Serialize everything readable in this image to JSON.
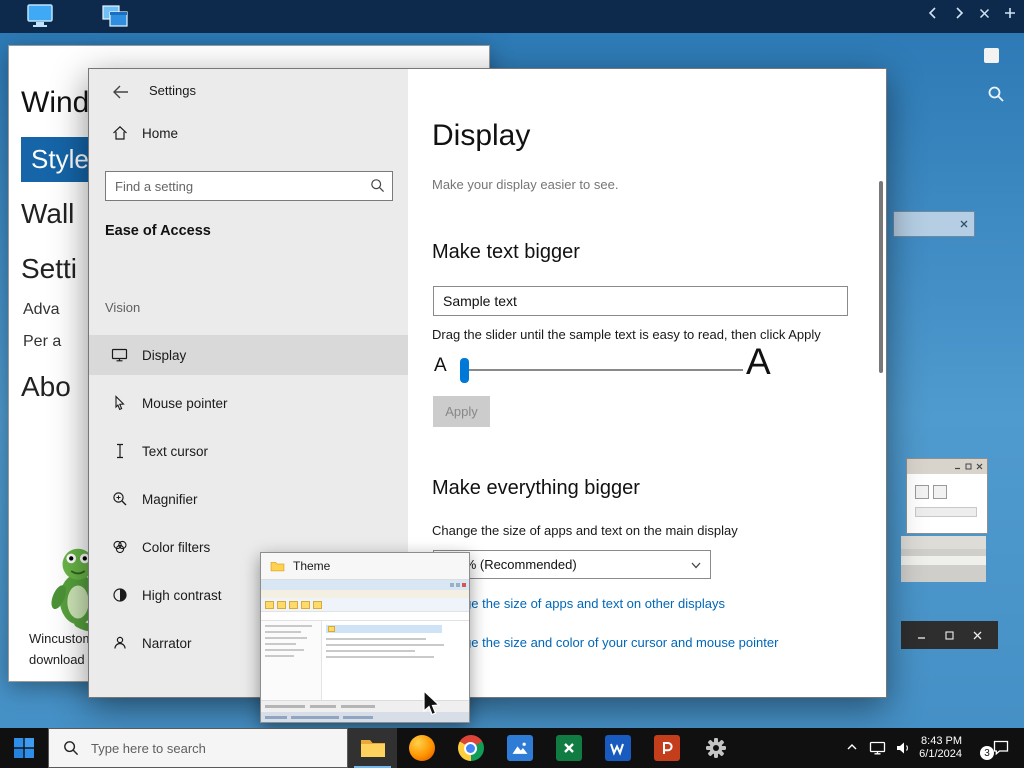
{
  "background_app": {
    "heading": "Wind",
    "selected_item": "Style",
    "items": [
      {
        "label": "Wall"
      },
      {
        "label": "Setti"
      },
      {
        "label": "Adva"
      },
      {
        "label": "Per a"
      },
      {
        "label": "Abo"
      }
    ],
    "caption_line1": "Wincustom",
    "caption_line2": "download"
  },
  "settings_window": {
    "title": "Settings",
    "sidebar": {
      "home_label": "Home",
      "search_placeholder": "Find a setting",
      "section_heading": "Ease of Access",
      "group_heading": "Vision",
      "items": [
        {
          "label": "Display"
        },
        {
          "label": "Mouse pointer"
        },
        {
          "label": "Text cursor"
        },
        {
          "label": "Magnifier"
        },
        {
          "label": "Color filters"
        },
        {
          "label": "High contrast"
        },
        {
          "label": "Narrator"
        }
      ]
    },
    "main": {
      "page_title": "Display",
      "page_subtitle": "Make your display easier to see.",
      "text_section": {
        "heading": "Make text bigger",
        "sample_text": "Sample text",
        "instruction": "Drag the slider until the sample text is easy to read, then click Apply",
        "slider_small_label": "A",
        "slider_large_label": "A",
        "apply_label": "Apply"
      },
      "scale_section": {
        "heading": "Make everything bigger",
        "caption": "Change the size of apps and text on the main display",
        "dropdown_value": "100% (Recommended)",
        "link_other_displays": "Change the size of apps and text on other displays",
        "link_cursor_pointer": "Change the size and color of your cursor and mouse pointer"
      }
    }
  },
  "theme_window": {
    "title": "Theme"
  },
  "taskbar": {
    "search_placeholder": "Type here to search",
    "tray": {
      "time": "8:43 PM",
      "date": "6/1/2024",
      "notification_count": "3"
    }
  },
  "colors": {
    "accent": "#0078d7",
    "link": "#0067b8"
  }
}
